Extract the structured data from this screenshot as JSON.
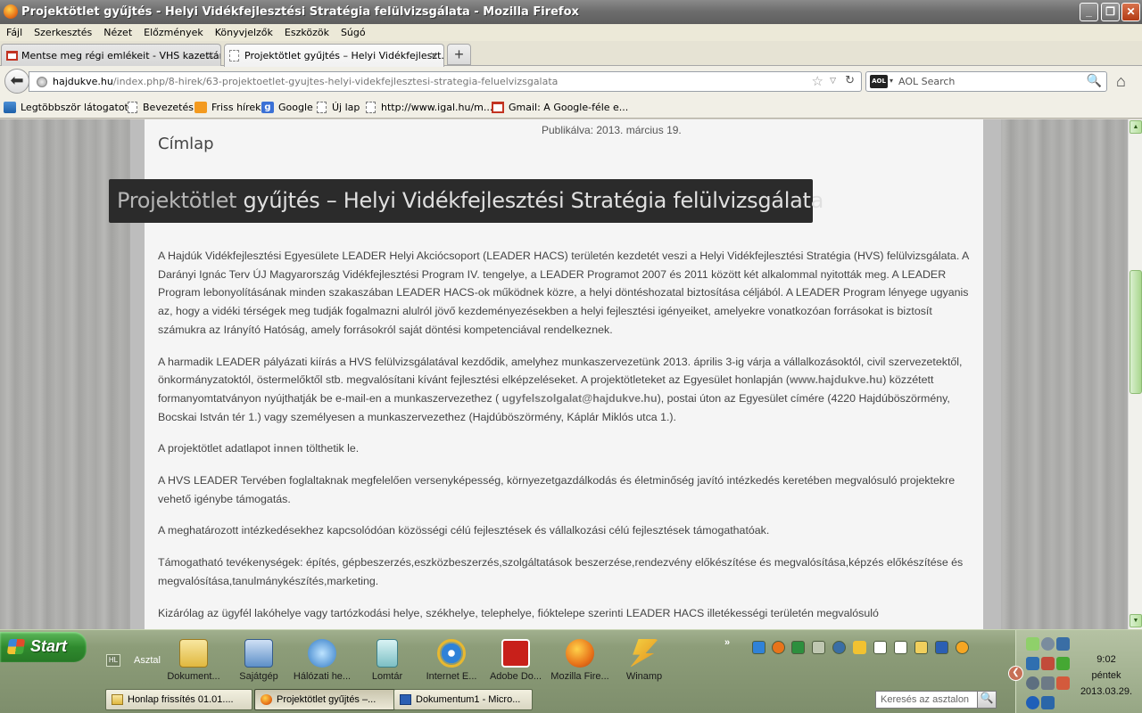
{
  "window": {
    "title": "Projektötlet gyűjtés - Helyi Vidékfejlesztési Stratégia felülvizsgálata - Mozilla Firefox",
    "minimize": "_",
    "maximize": "❐",
    "close": "✕"
  },
  "menu": [
    "Fájl",
    "Szerkesztés",
    "Nézet",
    "Előzmények",
    "Könyvjelzők",
    "Eszközök",
    "Súgó"
  ],
  "tabs": [
    {
      "label": "Mentse meg régi emlékeit - VHS kazettár...",
      "icon": "gmail-icon",
      "active": false
    },
    {
      "label": "Projektötlet gyűjtés – Helyi Vidékfejleszt...",
      "icon": "page-icon",
      "active": true
    }
  ],
  "newtab_label": "+",
  "tab_close": "×",
  "nav": {
    "back": "⬅",
    "url_domain": "hajdukve.hu",
    "url_path": "/index.php/8-hirek/63-projektoetlet-gyujtes-helyi-videkfejlesztesi-strategia-feluelvizsgalata",
    "search_engine": "AOL",
    "search_placeholder": "AOL Search",
    "star": "☆",
    "drop": "▽",
    "reload": "↻",
    "mag": "🔍",
    "home": "⌂"
  },
  "bookmarks": [
    {
      "label": "Legtöbbször látogatott",
      "icon": "most-visited"
    },
    {
      "label": "Bevezetés",
      "icon": "page"
    },
    {
      "label": "Friss hírek",
      "icon": "rss"
    },
    {
      "label": "Google",
      "icon": "google"
    },
    {
      "label": "Új lap",
      "icon": "page"
    },
    {
      "label": "http://www.igal.hu/m...",
      "icon": "page"
    },
    {
      "label": "Gmail: A Google-féle e...",
      "icon": "gmail"
    }
  ],
  "page": {
    "breadcrumb": "Címlap",
    "published": "Publikálva: 2013. március 19.",
    "headline_part1": "Projektötlet",
    "headline_part2": "gyűjtés – Helyi Vidékfejlesztési Stratégia felülvizsgálata",
    "paragraphs": {
      "p1": "A Hajdúk Vidékfejlesztési Egyesülete LEADER Helyi Akciócsoport (LEADER HACS) területén kezdetét veszi a Helyi Vidékfejlesztési Stratégia (HVS) felülvizsgálata. A Darányi Ignác Terv ÚJ Magyarország Vidékfejlesztési Program IV. tengelye, a LEADER Programot 2007 és 2011 között két alkalommal nyitották meg. A LEADER Program lebonyolításának minden szakaszában LEADER HACS-ok működnek közre, a helyi döntéshozatal biztosítása céljából. A LEADER Program lényege ugyanis az, hogy a vidéki térségek meg tudják fogalmazni alulról jövő kezdeményezésekben a helyi fejlesztési igényeiket, amelyekre vonatkozóan forrásokat is biztosít számukra az Irányító Hatóság, amely forrásokról saját döntési kompetenciával rendelkeznek.",
      "p2_a": "A harmadik LEADER pályázati kiírás a HVS felülvizsgálatával kezdődik, amelyhez munkaszervezetünk 2013. április 3-ig várja a vállalkozásoktól, civil szervezetektől, önkormányzatoktól, östermelőktől stb. megvalósítani kívánt fejlesztési elképzeléseket. A projektötleteket az Egyesület honlapján (",
      "p2_link1": "www.hajdukve.hu",
      "p2_b": ") közzétett formanyomtatványon nyújthatják be e-mail-en a munkaszervezethez ( ",
      "p2_link2": "ugyfelszolgalat@hajdukve.hu",
      "p2_c": "), postai úton az Egyesület címére (4220 Hajdúböszörmény, Bocskai István tér 1.) vagy személyesen a munkaszervezethez (Hajdúböszörmény, Káplár Miklós utca 1.).",
      "p3_a": " A projektötlet adatlapot ",
      "p3_link": "innen",
      "p3_b": " tölthetik le.",
      "p4": "A HVS LEADER Tervében foglaltaknak megfelelően versenyképesség, környezetgazdálkodás és életminőség javító intézkedés keretében megvalósuló projektekre vehető igénybe támogatás.",
      "p5": "A meghatározott intézkedésekhez kapcsolódóan közösségi célú fejlesztések és vállalkozási célú fejlesztések támogathatóak.",
      "p6": "Támogatható tevékenységek: építés, gépbeszerzés,eszközbeszerzés,szolgáltatások beszerzése,rendezvény előkészítése és megvalósítása,képzés előkészítése és megvalósítása,tanulmánykészítés,marketing.",
      "p7": "Kizárólag az ügyfél lakóhelye vagy tartózkodási helye, székhelye, telephelye, fióktelepe szerinti LEADER HACS illetékességi területén megvalósuló"
    }
  },
  "taskbar": {
    "start": "Start",
    "quicklaunch_badge": "HL",
    "asztal": "Asztal",
    "desktop_icons": [
      "Dokument...",
      "Sajátgép",
      "Hálózati he...",
      "Lomtár",
      "Internet E...",
      "Adobe Do...",
      "Mozilla Fire...",
      "Winamp"
    ],
    "chevron": "»",
    "tasks": [
      {
        "label": "Honlap frissítés 01.01....",
        "icon": "folder",
        "active": false
      },
      {
        "label": "Projektötlet gyűjtés –...",
        "icon": "firefox",
        "active": true
      },
      {
        "label": "Dokumentum1 - Micro...",
        "icon": "word",
        "active": false
      }
    ],
    "search_placeholder": "Keresés az asztalon",
    "search_mag": "🔍",
    "collapse": "❮",
    "clock_time": "9:02",
    "clock_day": "péntek",
    "clock_date": "2013.03.29."
  }
}
